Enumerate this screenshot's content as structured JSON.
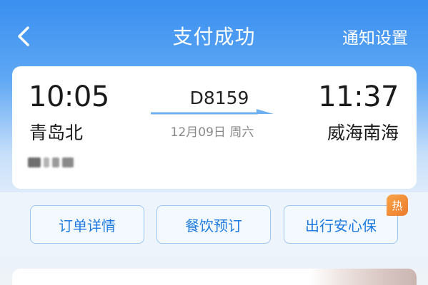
{
  "header": {
    "title": "支付成功",
    "notify_label": "通知设置"
  },
  "trip": {
    "departure_time": "10:05",
    "departure_station": "青岛北",
    "train_number": "D8159",
    "date": "12月09日 周六",
    "arrival_time": "11:37",
    "arrival_station": "威海南海"
  },
  "actions": {
    "order_details": "订单详情",
    "meal_booking": "餐饮预订",
    "travel_insurance": "出行安心保",
    "hot_badge": "热"
  },
  "colors": {
    "accent": "#1e7be0",
    "header_blue": "#3a8ff0",
    "hot_orange": "#f08a33"
  },
  "icons": {
    "back": "chevron-left-icon",
    "arrow": "right-arrow-icon"
  }
}
